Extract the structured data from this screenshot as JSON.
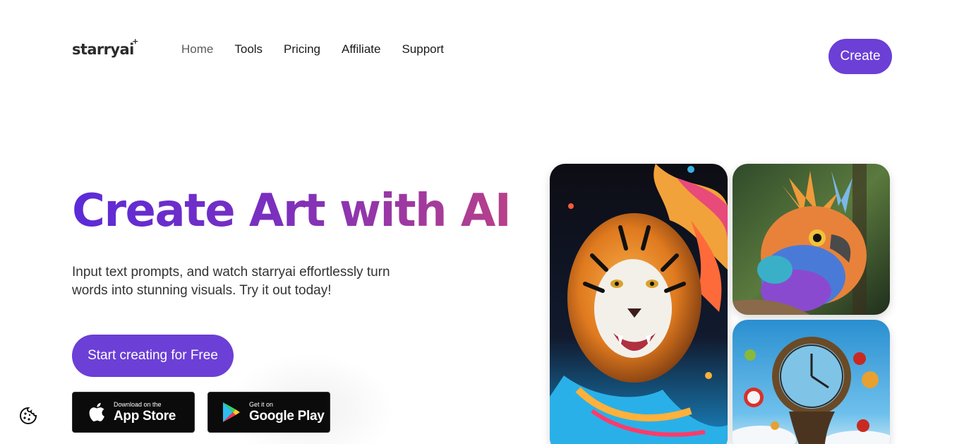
{
  "header": {
    "logo_text": "starryai",
    "nav": [
      {
        "label": "Home",
        "active": true
      },
      {
        "label": "Tools",
        "active": false
      },
      {
        "label": "Pricing",
        "active": false
      },
      {
        "label": "Affiliate",
        "active": false
      },
      {
        "label": "Support",
        "active": false
      }
    ],
    "create_label": "Create"
  },
  "hero": {
    "title": "Create Art with AI",
    "subtitle": "Input text prompts, and watch starryai effortlessly turn words into stunning visuals. Try it out today!",
    "cta_label": "Start creating for Free"
  },
  "stores": {
    "apple": {
      "small": "Download on the",
      "big": "App Store"
    },
    "google": {
      "small": "Get it on",
      "big": "Google Play"
    }
  },
  "colors": {
    "accent": "#6c3fd6",
    "title_gradient_start": "#5b2bd8",
    "title_gradient_end": "#b8408a"
  },
  "gallery": [
    {
      "subject": "tiger with colorful paint splash"
    },
    {
      "subject": "colorful bird of prey"
    },
    {
      "subject": "surreal melting clock with apples"
    }
  ]
}
